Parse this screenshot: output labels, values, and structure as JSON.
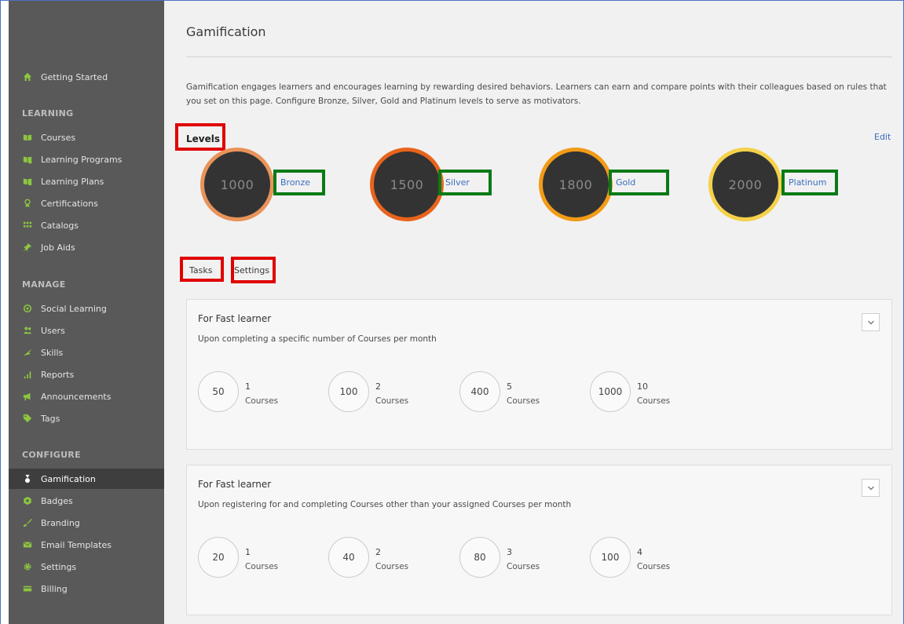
{
  "sidebar": {
    "getting_started": "Getting Started",
    "sections": {
      "learning": "LEARNING",
      "manage": "MANAGE",
      "configure": "CONFIGURE"
    },
    "learning_items": [
      {
        "label": "Courses",
        "icon": "book-icon"
      },
      {
        "label": "Learning Programs",
        "icon": "program-icon"
      },
      {
        "label": "Learning Plans",
        "icon": "plan-icon"
      },
      {
        "label": "Certifications",
        "icon": "certificate-icon"
      },
      {
        "label": "Catalogs",
        "icon": "grid-icon"
      },
      {
        "label": "Job Aids",
        "icon": "pin-icon"
      }
    ],
    "manage_items": [
      {
        "label": "Social Learning",
        "icon": "social-icon"
      },
      {
        "label": "Users",
        "icon": "users-icon"
      },
      {
        "label": "Skills",
        "icon": "skills-icon"
      },
      {
        "label": "Reports",
        "icon": "bar-chart-icon"
      },
      {
        "label": "Announcements",
        "icon": "megaphone-icon"
      },
      {
        "label": "Tags",
        "icon": "tag-icon"
      }
    ],
    "configure_items": [
      {
        "label": "Gamification",
        "icon": "medal-icon",
        "active": true
      },
      {
        "label": "Badges",
        "icon": "badge-icon"
      },
      {
        "label": "Branding",
        "icon": "brush-icon"
      },
      {
        "label": "Email Templates",
        "icon": "email-icon"
      },
      {
        "label": "Settings",
        "icon": "gear-icon"
      },
      {
        "label": "Billing",
        "icon": "card-icon"
      }
    ]
  },
  "main": {
    "title": "Gamification",
    "description": "Gamification engages learners and encourages learning by rewarding desired behaviors. Learners can earn and compare points with their colleagues based on rules that you set on this page. Configure Bronze, Silver, Gold and Platinum levels to serve as motivators.",
    "levels_label": "Levels",
    "edit_label": "Edit",
    "levels": [
      {
        "points": "1000",
        "name": "Bronze",
        "ring": "#e8935a"
      },
      {
        "points": "1500",
        "name": "Silver",
        "ring": "#e8641c"
      },
      {
        "points": "1800",
        "name": "Gold",
        "ring": "#f29b17"
      },
      {
        "points": "2000",
        "name": "Platinum",
        "ring": "#f5d14a"
      }
    ],
    "tabs": {
      "tasks": "Tasks",
      "settings": "Settings"
    },
    "cards": [
      {
        "title": "For Fast learner",
        "subtitle": "Upon completing a specific number of Courses per month",
        "rules": [
          {
            "points": "50",
            "count": "1",
            "unit": "Courses"
          },
          {
            "points": "100",
            "count": "2",
            "unit": "Courses"
          },
          {
            "points": "400",
            "count": "5",
            "unit": "Courses"
          },
          {
            "points": "1000",
            "count": "10",
            "unit": "Courses"
          }
        ]
      },
      {
        "title": "For Fast learner",
        "subtitle": "Upon registering for and completing Courses other than your assigned Courses per month",
        "rules": [
          {
            "points": "20",
            "count": "1",
            "unit": "Courses"
          },
          {
            "points": "40",
            "count": "2",
            "unit": "Courses"
          },
          {
            "points": "80",
            "count": "3",
            "unit": "Courses"
          },
          {
            "points": "100",
            "count": "4",
            "unit": "Courses"
          }
        ]
      }
    ]
  },
  "colors": {
    "sidebar_bg": "#595959",
    "sidebar_active": "#3e3e3e",
    "icon_accent": "#8dc63f",
    "link": "#3b6dbf",
    "highlight_red": "#e00000",
    "highlight_green": "#0a7a16"
  }
}
